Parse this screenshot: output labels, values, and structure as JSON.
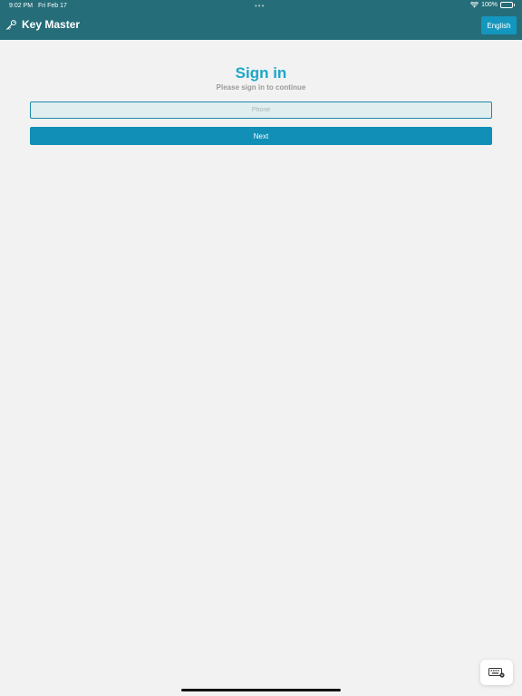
{
  "status_bar": {
    "time": "9:02 PM",
    "date": "Fri Feb 17",
    "battery": "100%"
  },
  "header": {
    "title": "Key Master",
    "language_button": "English",
    "bg_color": "#256d79"
  },
  "signin": {
    "title": "Sign in",
    "subtitle": "Please sign in to continue",
    "phone_placeholder": "Phone",
    "phone_value": "",
    "next_label": "Next"
  },
  "colors": {
    "accent": "#1ba7c8",
    "button": "#128fb6",
    "background": "#f2f2f2"
  },
  "icons": {
    "brand": "key-icon",
    "keyboard": "keyboard-icon",
    "wifi": "wifi-icon",
    "battery": "battery-icon"
  }
}
